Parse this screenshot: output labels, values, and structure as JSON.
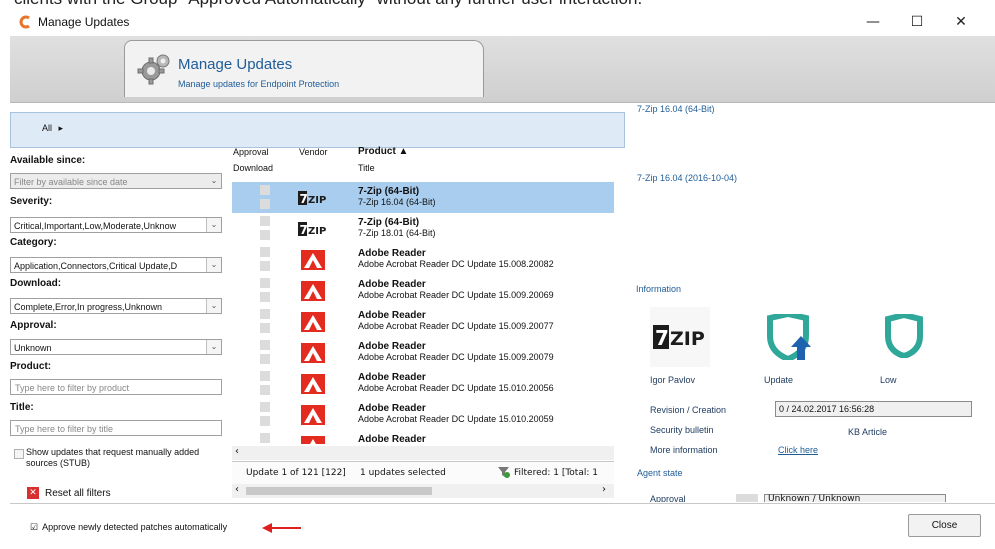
{
  "caption_strip": "clients with the Group \"Approved Automatically\" without any further user interaction.",
  "window": {
    "title": "Manage Updates",
    "minimize": "—",
    "maximize": "☐",
    "close": "✕"
  },
  "header": {
    "title": "Manage Updates",
    "subtitle": "Manage updates for Endpoint Protection"
  },
  "breadcrumb": {
    "label": "All",
    "arrow": "▸"
  },
  "filters": {
    "available_since": {
      "label": "Available since:",
      "placeholder": "Filter by available since date"
    },
    "severity": {
      "label": "Severity:",
      "value": "Critical,Important,Low,Moderate,Unknow"
    },
    "category": {
      "label": "Category:",
      "value": "Application,Connectors,Critical Update,D"
    },
    "download": {
      "label": "Download:",
      "value": "Complete,Error,In progress,Unknown"
    },
    "approval": {
      "label": "Approval:",
      "value": "Unknown"
    },
    "product": {
      "label": "Product:",
      "placeholder": "Type here to filter by product"
    },
    "title": {
      "label": "Title:",
      "placeholder": "Type here to filter by title"
    },
    "show_stub": "Show updates that request manually added sources (STUB)",
    "reset": "Reset all filters"
  },
  "list": {
    "col_approval": "Approval",
    "col_download": "Download",
    "col_vendor": "Vendor",
    "col_product": "Product ▲",
    "col_title": "Title",
    "rows": [
      {
        "product": "7-Zip (64-Bit)",
        "title": "7-Zip 16.04 (64-Bit)",
        "vendor_icon": "7zip-logo-icon"
      },
      {
        "product": "7-Zip (64-Bit)",
        "title": "7-Zip 18.01 (64-Bit)",
        "vendor_icon": "7zip-logo-icon"
      },
      {
        "product": "Adobe Reader",
        "title": "Adobe Acrobat Reader DC Update 15.008.20082",
        "vendor_icon": "adobe-logo-icon"
      },
      {
        "product": "Adobe Reader",
        "title": "Adobe Acrobat Reader DC Update 15.009.20069",
        "vendor_icon": "adobe-logo-icon"
      },
      {
        "product": "Adobe Reader",
        "title": "Adobe Acrobat Reader DC Update 15.009.20077",
        "vendor_icon": "adobe-logo-icon"
      },
      {
        "product": "Adobe Reader",
        "title": "Adobe Acrobat Reader DC Update 15.009.20079",
        "vendor_icon": "adobe-logo-icon"
      },
      {
        "product": "Adobe Reader",
        "title": "Adobe Acrobat Reader DC Update 15.010.20056",
        "vendor_icon": "adobe-logo-icon"
      },
      {
        "product": "Adobe Reader",
        "title": "Adobe Acrobat Reader DC Update 15.010.20059",
        "vendor_icon": "adobe-logo-icon"
      },
      {
        "product": "Adobe Reader",
        "title": "",
        "vendor_icon": "adobe-logo-icon"
      }
    ],
    "status_count": "Update 1 of 121 [122]",
    "status_selected": "1 updates selected",
    "status_filtered": "Filtered: 1 [Total: 1"
  },
  "details": {
    "name": "7-Zip 16.04 (64-Bit)",
    "title_date": "7-Zip 16.04 (2016-10-04)",
    "information": "Information",
    "vendor": "Igor Pavlov",
    "classification": "Update",
    "severity": "Low",
    "revision_label": "Revision / Creation",
    "revision_value": "0 / 24.02.2017 16:56:28",
    "bulletin_label": "Security bulletin",
    "bulletin_value": "KB Article",
    "more_label": "More information",
    "more_link": "Click here",
    "agent_state": "Agent state",
    "approval_label": "Approval",
    "approval_value": "Unknown / Unknown"
  },
  "footer": {
    "approve_auto": "Approve newly detected patches automatically",
    "close": "Close"
  },
  "colors": {
    "accent": "#1f5c98",
    "selection": "#a9cdee",
    "arrow": "#e02020",
    "shield": "#2fa89a"
  }
}
